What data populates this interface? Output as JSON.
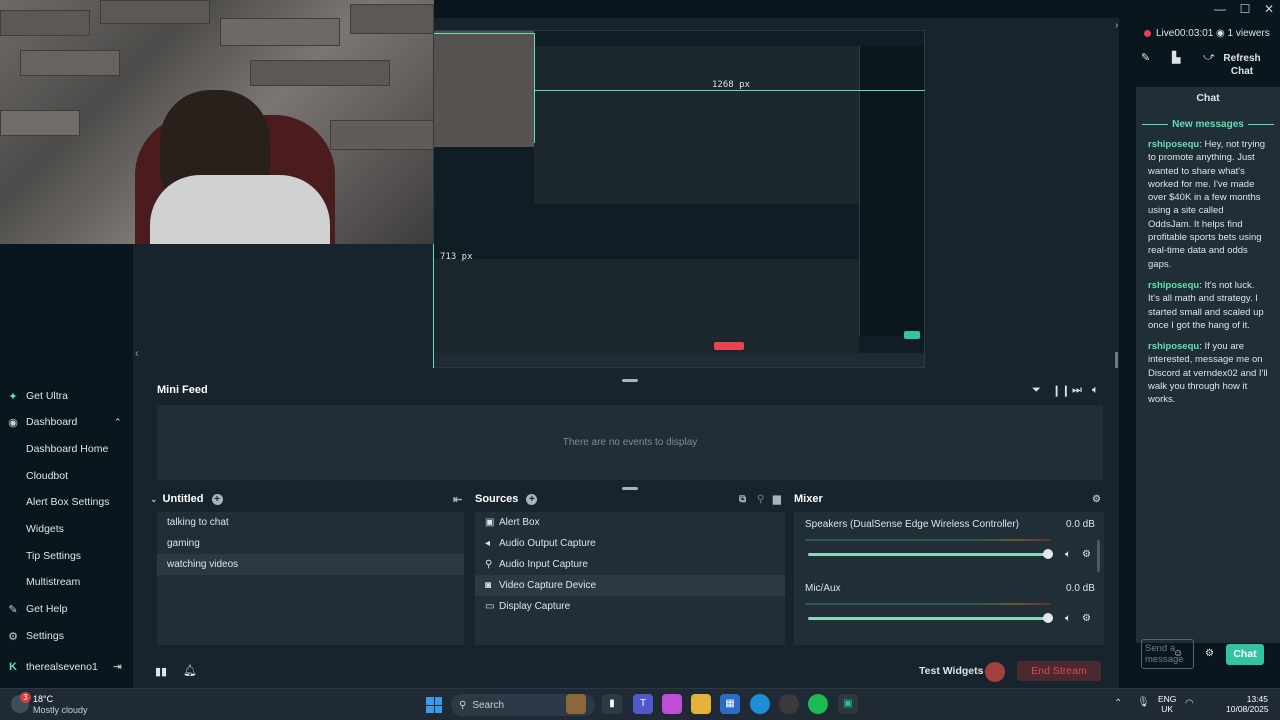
{
  "stream": {
    "live_label": "Live",
    "timer": "00:03:01",
    "viewers": "1 viewers",
    "refresh_chat": "Refresh Chat"
  },
  "chat": {
    "title": "Chat",
    "new_messages": "New messages",
    "messages": [
      {
        "user": "rshiposequ",
        "text": ": Hey, not trying to promote anything. Just wanted to share what's worked for me. I've made over $40K in a few months using a site called OddsJam. It helps find profitable sports bets using real-time data and odds gaps."
      },
      {
        "user": "rshiposequ",
        "text": ": It's not luck. It's all math and strategy. I started small and scaled up once I got the hang of it."
      },
      {
        "user": "rshiposequ",
        "text": ": If you are interested, message me on Discord at verndex02 and I'll walk you through how it works."
      }
    ],
    "input_placeholder": "Send a message",
    "send_label": "Chat"
  },
  "sidebar": {
    "items": [
      {
        "label": "Get Ultra",
        "icon": "ultra-icon"
      },
      {
        "label": "Dashboard",
        "icon": "dashboard-icon"
      },
      {
        "label": "Dashboard Home"
      },
      {
        "label": "Cloudbot"
      },
      {
        "label": "Alert Box Settings"
      },
      {
        "label": "Widgets"
      },
      {
        "label": "Tip Settings"
      },
      {
        "label": "Multistream"
      },
      {
        "label": "Get Help",
        "icon": "help-icon"
      },
      {
        "label": "Settings",
        "icon": "gear-icon"
      }
    ],
    "user": "therealseveno1"
  },
  "preview": {
    "measure_w": "1268 px",
    "measure_h": "713 px"
  },
  "minifeed": {
    "title": "Mini Feed",
    "empty": "There are no events to display"
  },
  "scenes": {
    "title": "Untitled",
    "items": [
      "talking to chat",
      "gaming",
      "watching videos"
    ],
    "selected": 2
  },
  "sources": {
    "title": "Sources",
    "items": [
      {
        "label": "Alert Box",
        "icon": "alert-box-icon"
      },
      {
        "label": "Audio Output Capture",
        "icon": "speaker-icon"
      },
      {
        "label": "Audio Input Capture",
        "icon": "mic-icon"
      },
      {
        "label": "Video Capture Device",
        "icon": "camera-icon"
      },
      {
        "label": "Display Capture",
        "icon": "monitor-icon"
      }
    ],
    "selected": 3
  },
  "mixer": {
    "title": "Mixer",
    "channels": [
      {
        "name": "Speakers (DualSense Edge Wireless Controller)",
        "db": "0.0 dB",
        "level": 1.0
      },
      {
        "name": "Mic/Aux",
        "db": "0.0 dB",
        "level": 1.0
      }
    ]
  },
  "bottom": {
    "test_widgets": "Test Widgets",
    "end_stream": "End Stream"
  },
  "taskbar": {
    "weather_temp": "18°C",
    "weather_desc": "Mostly cloudy",
    "weather_badge": "3",
    "search": "Search",
    "lang": "ENG",
    "region": "UK",
    "time": "13:45",
    "date": "10/08/2025"
  },
  "colors": {
    "accent": "#31c3a2",
    "green": "#5fe0b3",
    "end_stream": "#e54450",
    "bg": "#17242d",
    "panel": "#09161d"
  }
}
